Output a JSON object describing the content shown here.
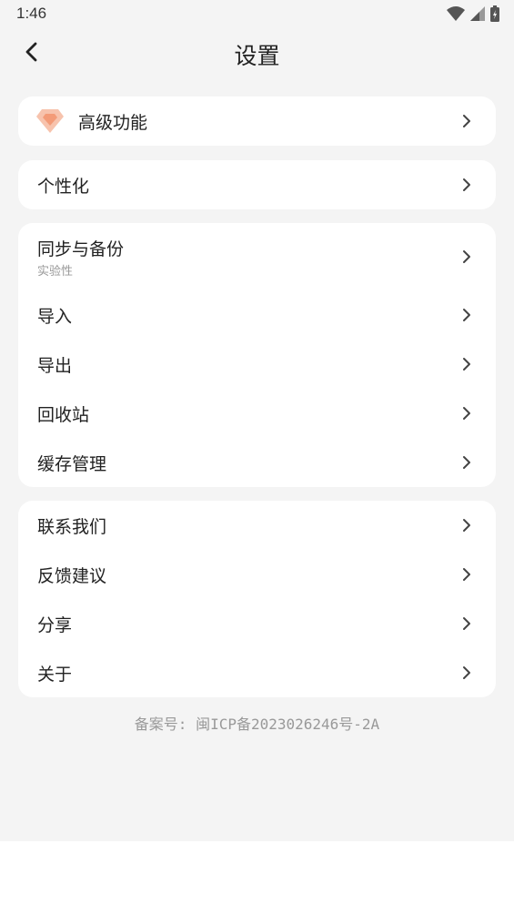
{
  "status_bar": {
    "time": "1:46"
  },
  "header": {
    "title": "设置"
  },
  "cards": {
    "premium": {
      "label": "高级功能"
    },
    "personalize": {
      "label": "个性化"
    },
    "data": {
      "sync_label": "同步与备份",
      "sync_sub": "实验性",
      "import_label": "导入",
      "export_label": "导出",
      "recycle_label": "回收站",
      "cache_label": "缓存管理"
    },
    "about": {
      "contact_label": "联系我们",
      "feedback_label": "反馈建议",
      "share_label": "分享",
      "about_label": "关于"
    }
  },
  "footer": {
    "icp": "备案号: 闽ICP备2023026246号-2A"
  },
  "colors": {
    "accent_gem": "#f6b99e",
    "background": "#f4f4f4",
    "card": "#ffffff"
  }
}
